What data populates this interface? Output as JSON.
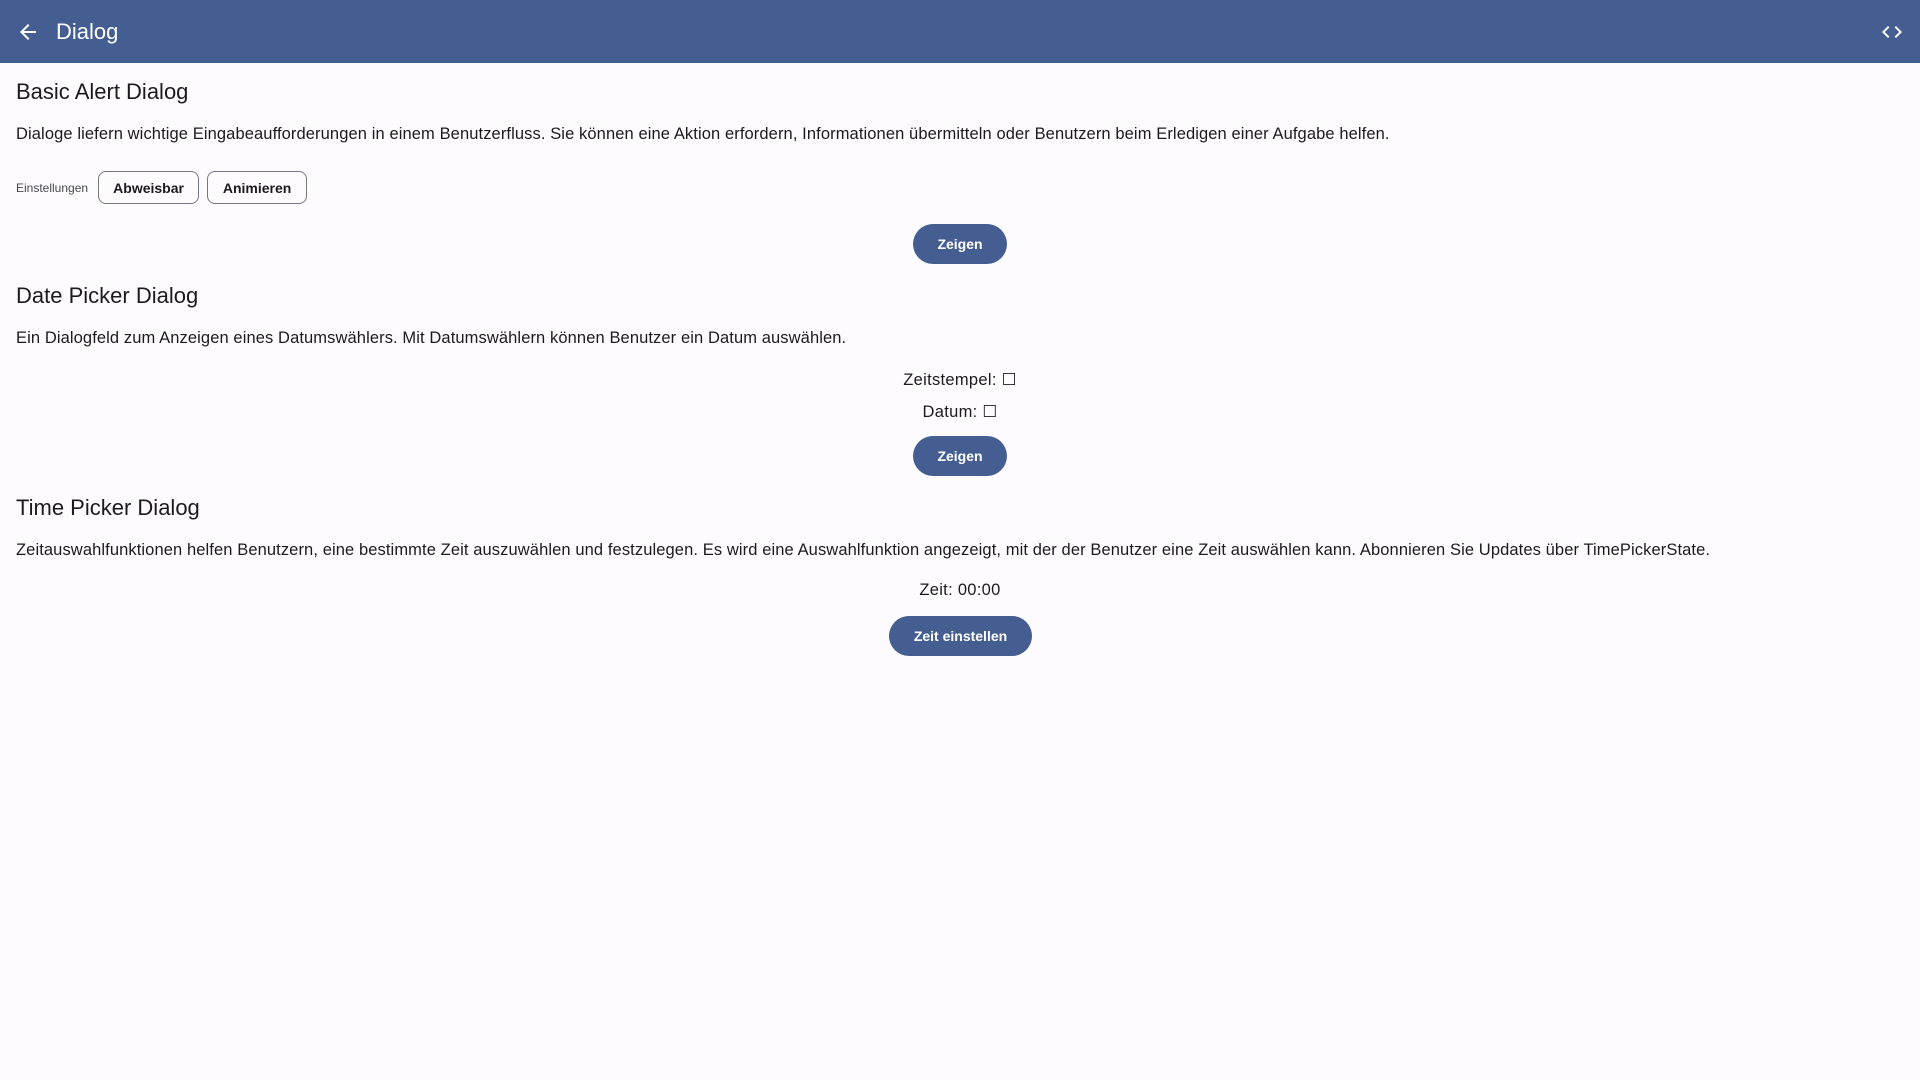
{
  "app_bar": {
    "title": "Dialog",
    "back_icon": "arrow-back-icon",
    "code_icon": "code-icon",
    "bg_color": "#445e91"
  },
  "basic_alert": {
    "title": "Basic Alert Dialog",
    "description": "Dialoge liefern wichtige Eingabeaufforderungen in einem Benutzerfluss. Sie können eine Aktion erfordern, Informationen übermitteln oder Benutzern beim Erledigen einer Aufgabe helfen.",
    "settings_label": "Einstellungen",
    "chips": [
      "Abweisbar",
      "Animieren"
    ],
    "show_button": "Zeigen"
  },
  "date_picker": {
    "title": "Date Picker Dialog",
    "description": "Ein Dialogfeld zum Anzeigen eines Datumswählers. Mit Datumswählern können Benutzer ein Datum auswählen.",
    "timestamp_text": "Zeitstempel: ☐",
    "date_text": "Datum: ☐",
    "show_button": "Zeigen"
  },
  "time_picker": {
    "title": "Time Picker Dialog",
    "description": "Zeitauswahlfunktionen helfen Benutzern, eine bestimmte Zeit auszuwählen und festzulegen. Es wird eine Auswahlfunktion angezeigt, mit der der Benutzer eine Zeit auswählen kann. Abonnieren Sie Updates über TimePickerState.",
    "time_text": "Zeit: 00:00",
    "set_button": "Zeit einstellen"
  }
}
